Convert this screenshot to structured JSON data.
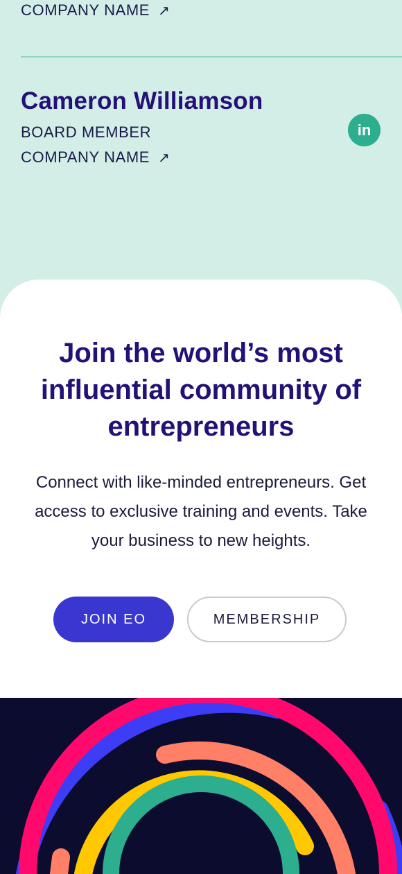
{
  "previous_member": {
    "company": "COMPANY NAME",
    "arrow_icon": "↗"
  },
  "member": {
    "name": "Cameron Williamson",
    "role": "BOARD MEMBER",
    "company": "COMPANY NAME",
    "arrow_icon": "↗",
    "linkedin_label": "in"
  },
  "cta": {
    "title": "Join the world’s most influential community of entrepreneurs",
    "body": "Connect with like-minded entrepreneurs. Get access to exclusive training and events. Take your business to new heights.",
    "primary_button": "JOIN EO",
    "secondary_button": "MEMBERSHIP"
  },
  "colors": {
    "mint_bg": "#d3eee6",
    "brand_purple": "#231177",
    "button_blue": "#3a37d1",
    "linkedin_green": "#2dae8f",
    "footer_navy": "#0c0c2e"
  }
}
